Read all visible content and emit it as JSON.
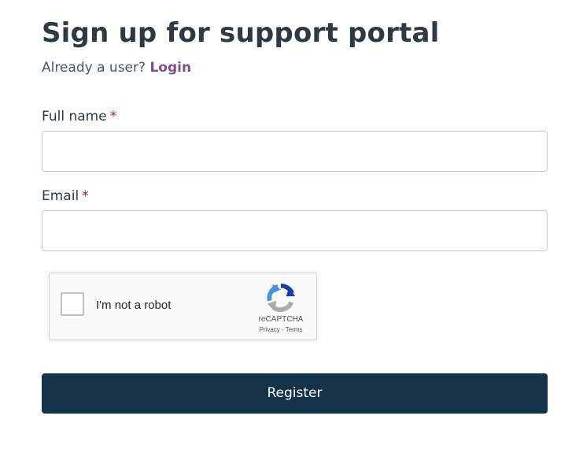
{
  "page": {
    "title": "Sign up for support portal",
    "existing_user_prompt": "Already a user?",
    "login_link": "Login"
  },
  "form": {
    "full_name": {
      "label": "Full name",
      "required_mark": "*",
      "value": "",
      "placeholder": ""
    },
    "email": {
      "label": "Email",
      "required_mark": "*",
      "value": "",
      "placeholder": ""
    },
    "submit_label": "Register"
  },
  "recaptcha": {
    "checkbox_label": "I'm not a robot",
    "checked": false,
    "brand": "reCAPTCHA",
    "privacy_link": "Privacy",
    "separator": " - ",
    "terms_link": "Terms"
  },
  "colors": {
    "accent_link": "#7a4f96",
    "required": "#a0202f",
    "button_background": "#14334a",
    "text": "#2f3941"
  }
}
